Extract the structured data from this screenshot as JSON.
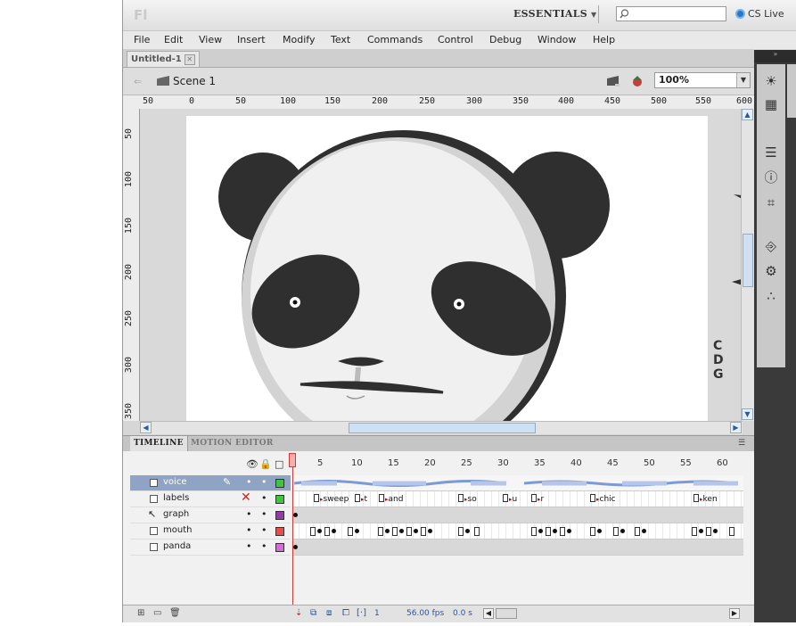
{
  "app": {
    "logo": "Fl",
    "workspace": "ESSENTIALS",
    "cs_live": "CS Live"
  },
  "menu": [
    "File",
    "Edit",
    "View",
    "Insert",
    "Modify",
    "Text",
    "Commands",
    "Control",
    "Debug",
    "Window",
    "Help"
  ],
  "document": {
    "tab": "Untitled-1",
    "scene": "Scene 1",
    "zoom": "100%"
  },
  "ruler_h": [
    "50",
    "0",
    "50",
    "100",
    "150",
    "200",
    "250",
    "300",
    "350",
    "400",
    "450",
    "500",
    "550",
    "600"
  ],
  "ruler_v": [
    "50",
    "100",
    "150",
    "200",
    "250",
    "300",
    "350"
  ],
  "stage_text": "C D G",
  "timeline": {
    "tabs": [
      "TIMELINE",
      "MOTION EDITOR"
    ],
    "frame_numbers": [
      "5",
      "10",
      "15",
      "20",
      "25",
      "30",
      "35",
      "40",
      "45",
      "50",
      "55",
      "60"
    ],
    "layers": [
      {
        "name": "voice",
        "color": "#3fc43f",
        "selected": true
      },
      {
        "name": "labels",
        "color": "#3fc43f",
        "selected": false
      },
      {
        "name": "graph",
        "color": "#8f3f9f",
        "selected": false
      },
      {
        "name": "mouth",
        "color": "#e05050",
        "selected": false
      },
      {
        "name": "panda",
        "color": "#d070d0",
        "selected": false
      }
    ],
    "labels": [
      "sweep",
      "t",
      "and",
      "so",
      "u",
      "r",
      "chic",
      "ken"
    ],
    "frame": "1",
    "fps": "56.00",
    "fps_unit": "fps",
    "time": "0.0",
    "time_unit": "s"
  },
  "colors": {
    "panda_dark": "#2f2f2f",
    "stage_bg": "#ffffff",
    "selection": "#8fa3c4",
    "playhead": "#dd3333"
  }
}
